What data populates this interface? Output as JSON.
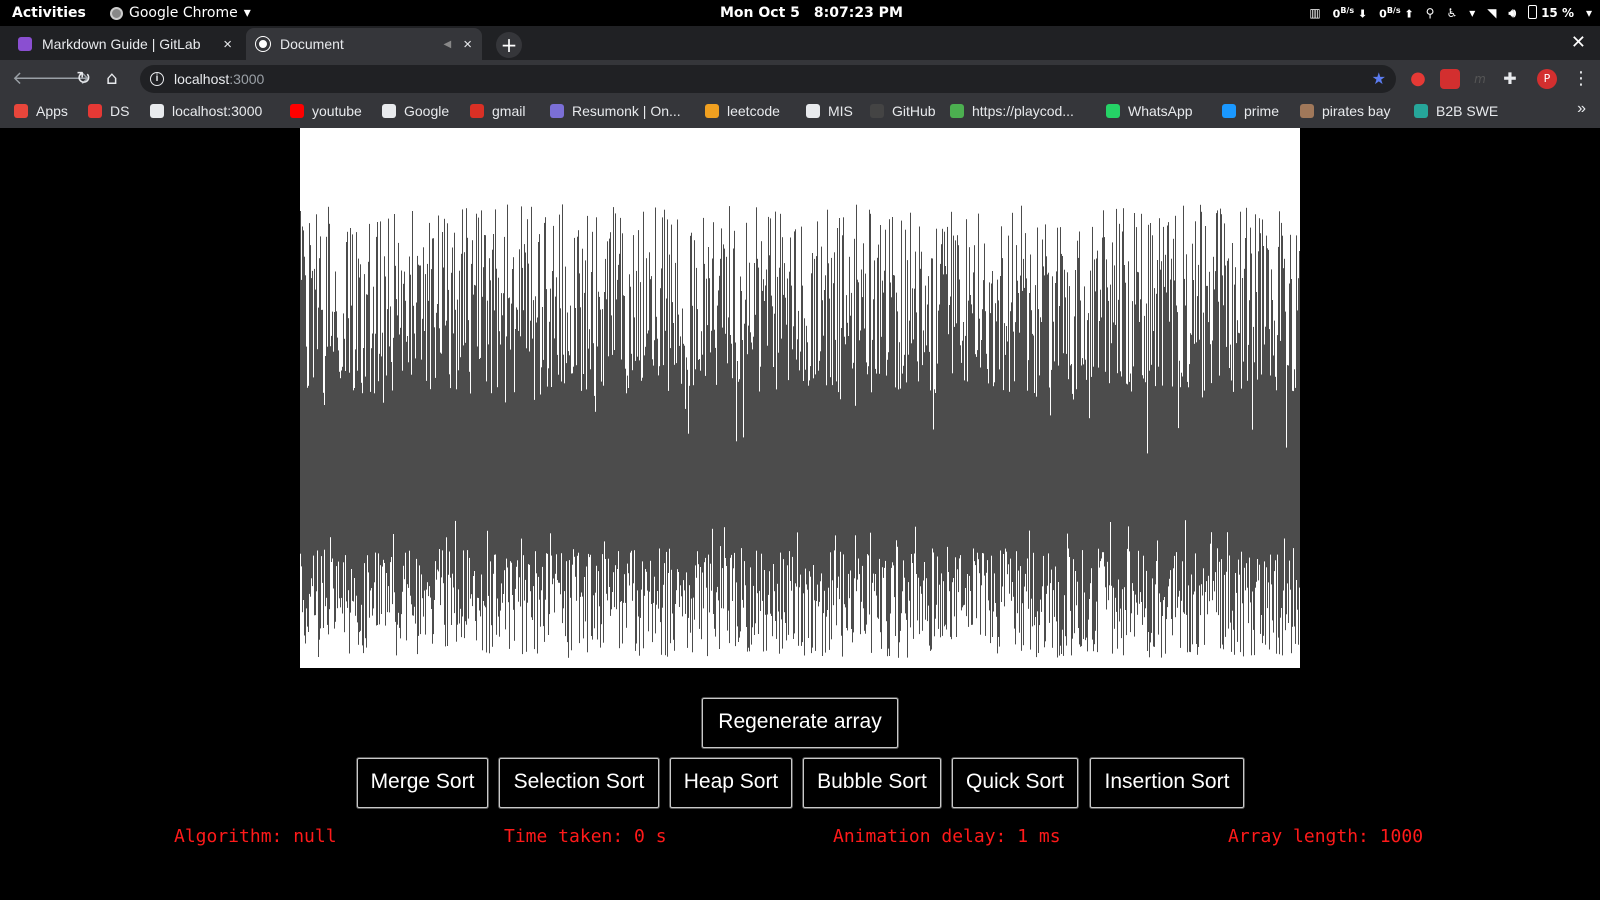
{
  "topbar": {
    "activities": "Activities",
    "app_name": "Google Chrome",
    "date": "Mon Oct 5",
    "time": "8:07:23 PM",
    "net_down": "0",
    "net_up": "0",
    "net_unit": "B/s",
    "battery": "15 %"
  },
  "tabs": [
    {
      "title": "Markdown Guide | GitLab",
      "close": "×"
    },
    {
      "title": "Document",
      "close": "×"
    }
  ],
  "new_tab": "+",
  "window_close": "✕",
  "address": {
    "host": "localhost",
    "port": ":3000"
  },
  "avatar_letter": "P",
  "bookmarks": [
    {
      "label": "Apps",
      "icon_color": "#e8463b"
    },
    {
      "label": "DS",
      "icon_color": "#e53935"
    },
    {
      "label": "localhost:3000",
      "icon_color": "#e8eaed"
    },
    {
      "label": "youtube",
      "icon_color": "#ff0000"
    },
    {
      "label": "Google",
      "icon_color": "#e8eaed"
    },
    {
      "label": "gmail",
      "icon_color": "#d93025"
    },
    {
      "label": "Resumonk | On...",
      "icon_color": "#7b6fd6"
    },
    {
      "label": "leetcode",
      "icon_color": "#f0a020"
    },
    {
      "label": "MIS",
      "icon_color": "#e8eaed"
    },
    {
      "label": "GitHub",
      "icon_color": "#444444"
    },
    {
      "label": "https://playcod...",
      "icon_color": "#4caf50"
    },
    {
      "label": "WhatsApp",
      "icon_color": "#25d366"
    },
    {
      "label": "prime",
      "icon_color": "#1a98ff"
    },
    {
      "label": "pirates bay",
      "icon_color": "#a0785a"
    },
    {
      "label": "B2B SWE",
      "icon_color": "#26a69a"
    }
  ],
  "bookmarks_more": "»",
  "app": {
    "regenerate_label": "Regenerate array",
    "sort_buttons": [
      "Merge Sort",
      "Selection Sort",
      "Heap Sort",
      "Bubble Sort",
      "Quick Sort",
      "Insertion Sort"
    ],
    "stats": {
      "algorithm": "Algorithm: null",
      "time_taken": "Time taken: 0 s",
      "animation_delay": "Animation delay: 1 ms",
      "array_length": "Array length: 1000"
    },
    "colors": {
      "stat_text": "#ff1a1a",
      "bar_color": "#000000",
      "canvas_bg": "#ffffff"
    }
  }
}
